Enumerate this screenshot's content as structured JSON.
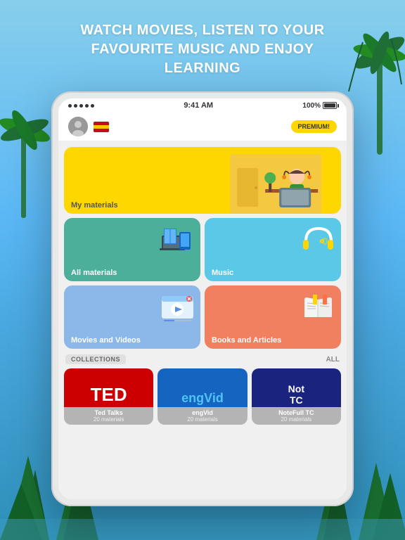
{
  "header": {
    "line1": "WATCH MOVIES, LISTEN TO YOUR",
    "line2": "FAVOURITE MUSIC AND ENJOY",
    "line3": "LEARNING"
  },
  "status_bar": {
    "time": "9:41 AM",
    "battery": "100%"
  },
  "nav": {
    "premium_label": "PREMIUM!"
  },
  "cards": {
    "my_materials": "My materials",
    "all_materials": "All materials",
    "music": "Music",
    "movies": "Movies and Videos",
    "books": "Books and Articles"
  },
  "collections": {
    "header": "COLLECTIONS",
    "all_label": "ALL",
    "items": [
      {
        "name": "Ted Talks",
        "logo": "TED",
        "count": "20 materials"
      },
      {
        "name": "engVid",
        "logo": "engVid",
        "count": "20 materials"
      },
      {
        "name": "NoteFull TC",
        "logo": "Not TC",
        "count": "20 materials"
      }
    ]
  }
}
